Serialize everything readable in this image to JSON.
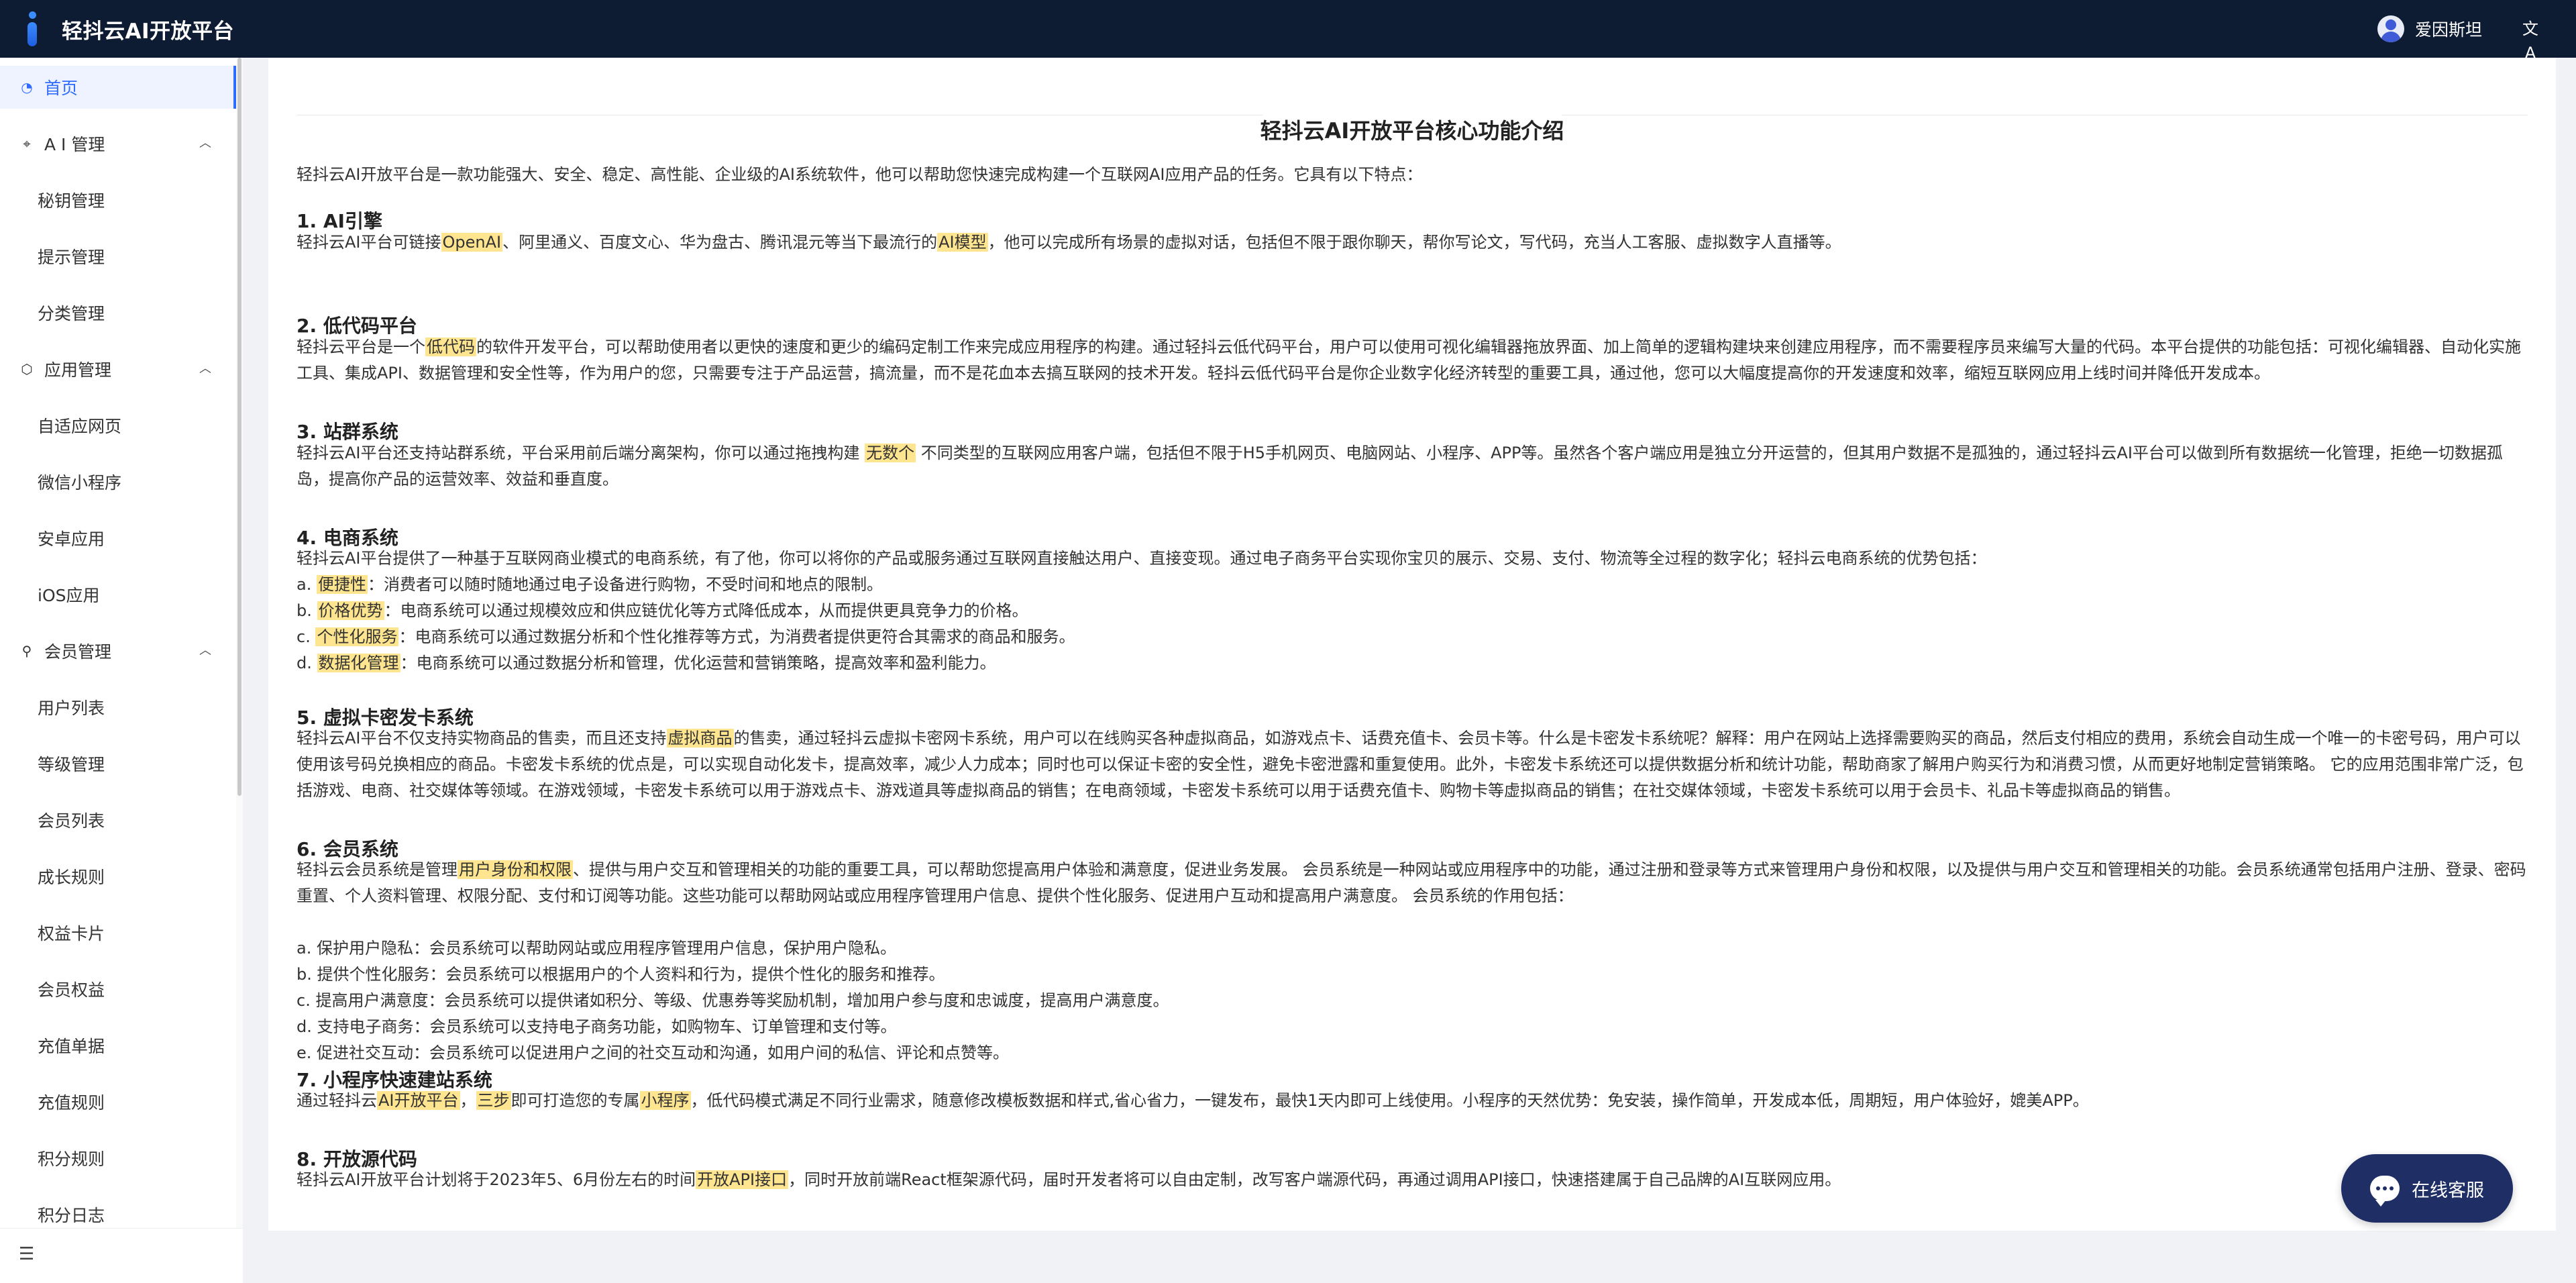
{
  "header": {
    "brand_title": "轻抖云AI开放平台",
    "user_name": "爱因斯坦",
    "lang_icon": "translate-icon"
  },
  "sidebar": {
    "home": "首页",
    "groups": [
      {
        "label": "A I 管理",
        "icon": "ai-icon",
        "items": [
          "秘钥管理",
          "提示管理",
          "分类管理"
        ]
      },
      {
        "label": "应用管理",
        "icon": "app-icon",
        "items": [
          "自适应网页",
          "微信小程序",
          "安卓应用",
          "iOS应用"
        ]
      },
      {
        "label": "会员管理",
        "icon": "user-icon",
        "items": [
          "用户列表",
          "等级管理",
          "会员列表",
          "成长规则",
          "权益卡片",
          "会员权益",
          "充值单据",
          "充值规则",
          "积分规则",
          "积分日志"
        ]
      }
    ]
  },
  "content": {
    "title": "轻抖云AI开放平台核心功能介绍",
    "intro": "轻抖云AI开放平台是一款功能强大、安全、稳定、高性能、企业级的AI系统软件，他可以帮助您快速完成构建一个互联网AI应用产品的任务。它具有以下特点：",
    "sections": [
      {
        "heading": "1. AI引擎",
        "paragraphs": [
          [
            {
              "t": "轻抖云AI平台可链接"
            },
            {
              "t": "OpenAI",
              "hl": true
            },
            {
              "t": "、阿里通义、百度文心、华为盘古、腾讯混元等当下最流行的"
            },
            {
              "t": "AI模型",
              "hl": true
            },
            {
              "t": "，他可以完成所有场景的虚拟对话，包括但不限于跟你聊天，帮你写论文，写代码，充当人工客服、虚拟数字人直播等。"
            }
          ]
        ]
      },
      {
        "heading": "2. 低代码平台",
        "paragraphs": [
          [
            {
              "t": "轻抖云平台是一个"
            },
            {
              "t": "低代码",
              "hl": true
            },
            {
              "t": "的软件开发平台，可以帮助使用者以更快的速度和更少的编码定制工作来完成应用程序的构建。通过轻抖云低代码平台，用户可以使用可视化编辑器拖放界面、加上简单的逻辑构建块来创建应用程序，而不需要程序员来编写大量的代码。本平台提供的功能包括：可视化编辑器、自动化实施工具、集成API、数据管理和安全性等，作为用户的您，只需要专注于产品运营，搞流量，而不是花血本去搞互联网的技术开发。轻抖云低代码平台是你企业数字化经济转型的重要工具，通过他，您可以大幅度提高你的开发速度和效率，缩短互联网应用上线时间并降低开发成本。"
            }
          ]
        ]
      },
      {
        "heading": "3. 站群系统",
        "paragraphs": [
          [
            {
              "t": "轻抖云AI平台还支持站群系统，平台采用前后端分离架构，你可以通过拖拽构建 "
            },
            {
              "t": "无数个",
              "hl": true
            },
            {
              "t": " 不同类型的互联网应用客户端，包括但不限于H5手机网页、电脑网站、小程序、APP等。虽然各个客户端应用是独立分开运营的，但其用户数据不是孤独的，通过轻抖云AI平台可以做到所有数据统一化管理，拒绝一切数据孤岛，提高你产品的运营效率、效益和垂直度。"
            }
          ]
        ]
      },
      {
        "heading": "4. 电商系统",
        "paragraphs": [
          [
            {
              "t": "轻抖云AI平台提供了一种基于互联网商业模式的电商系统，有了他，你可以将你的产品或服务通过互联网直接触达用户、直接变现。通过电子商务平台实现你宝贝的展示、交易、支付、物流等全过程的数字化；轻抖云电商系统的优势包括："
            }
          ],
          [
            {
              "t": "a. "
            },
            {
              "t": "便捷性",
              "hl": true
            },
            {
              "t": "：消费者可以随时随地通过电子设备进行购物，不受时间和地点的限制。"
            }
          ],
          [
            {
              "t": "b. "
            },
            {
              "t": "价格优势",
              "hl": true
            },
            {
              "t": "：电商系统可以通过规模效应和供应链优化等方式降低成本，从而提供更具竞争力的价格。"
            }
          ],
          [
            {
              "t": "c. "
            },
            {
              "t": "个性化服务",
              "hl": true
            },
            {
              "t": "：电商系统可以通过数据分析和个性化推荐等方式，为消费者提供更符合其需求的商品和服务。"
            }
          ],
          [
            {
              "t": "d. "
            },
            {
              "t": "数据化管理",
              "hl": true
            },
            {
              "t": "：电商系统可以通过数据分析和管理，优化运营和营销策略，提高效率和盈利能力。"
            }
          ]
        ]
      },
      {
        "heading": "5. 虚拟卡密发卡系统",
        "paragraphs": [
          [
            {
              "t": "轻抖云AI平台不仅支持实物商品的售卖，而且还支持"
            },
            {
              "t": "虚拟商品",
              "hl": true
            },
            {
              "t": "的售卖，通过轻抖云虚拟卡密网卡系统，用户可以在线购买各种虚拟商品，如游戏点卡、话费充值卡、会员卡等。什么是卡密发卡系统呢？解释：用户在网站上选择需要购买的商品，然后支付相应的费用，系统会自动生成一个唯一的卡密号码，用户可以使用该号码兑换相应的商品。卡密发卡系统的优点是，可以实现自动化发卡，提高效率，减少人力成本；同时也可以保证卡密的安全性，避免卡密泄露和重复使用。此外，卡密发卡系统还可以提供数据分析和统计功能，帮助商家了解用户购买行为和消费习惯，从而更好地制定营销策略。 它的应用范围非常广泛，包括游戏、电商、社交媒体等领域。在游戏领域，卡密发卡系统可以用于游戏点卡、游戏道具等虚拟商品的销售；在电商领域，卡密发卡系统可以用于话费充值卡、购物卡等虚拟商品的销售；在社交媒体领域，卡密发卡系统可以用于会员卡、礼品卡等虚拟商品的销售。"
            }
          ]
        ]
      },
      {
        "heading": "6. 会员系统",
        "paragraphs": [
          [
            {
              "t": "轻抖云会员系统是管理"
            },
            {
              "t": "用户身份和权限",
              "hl": true
            },
            {
              "t": "、提供与用户交互和管理相关的功能的重要工具，可以帮助您提高用户体验和满意度，促进业务发展。 会员系统是一种网站或应用程序中的功能，通过注册和登录等方式来管理用户身份和权限，以及提供与用户交互和管理相关的功能。会员系统通常包括用户注册、登录、密码重置、个人资料管理、权限分配、支付和订阅等功能。这些功能可以帮助网站或应用程序管理用户信息、提供个性化服务、促进用户互动和提高用户满意度。 会员系统的作用包括："
            }
          ],
          [
            {
              "t": "a. 保护用户隐私：会员系统可以帮助网站或应用程序管理用户信息，保护用户隐私。"
            }
          ],
          [
            {
              "t": "b. 提供个性化服务：会员系统可以根据用户的个人资料和行为，提供个性化的服务和推荐。"
            }
          ],
          [
            {
              "t": "c. 提高用户满意度：会员系统可以提供诸如积分、等级、优惠券等奖励机制，增加用户参与度和忠诚度，提高用户满意度。"
            }
          ],
          [
            {
              "t": "d. 支持电子商务：会员系统可以支持电子商务功能，如购物车、订单管理和支付等。"
            }
          ],
          [
            {
              "t": "e. 促进社交互动：会员系统可以促进用户之间的社交互动和沟通，如用户间的私信、评论和点赞等。"
            }
          ]
        ]
      },
      {
        "heading": "7. 小程序快速建站系统",
        "paragraphs": [
          [
            {
              "t": "通过轻抖云"
            },
            {
              "t": "AI开放平台",
              "hl": true
            },
            {
              "t": "，"
            },
            {
              "t": "三步",
              "hl": true
            },
            {
              "t": "即可打造您的专属"
            },
            {
              "t": "小程序",
              "hl": true
            },
            {
              "t": "，低代码模式满足不同行业需求，随意修改模板数据和样式,省心省力，一键发布，最快1天内即可上线使用。小程序的天然优势：免安装，操作简单，开发成本低，周期短，用户体验好，媲美APP。"
            }
          ]
        ]
      },
      {
        "heading": "8. 开放源代码",
        "paragraphs": [
          [
            {
              "t": "轻抖云AI开放平台计划将于2023年5、6月份左右的时间"
            },
            {
              "t": "开放API接口",
              "hl": true
            },
            {
              "t": "，同时开放前端React框架源代码，届时开发者将可以自由定制，改写客户端源代码，再通过调用API接口，快速搭建属于自己品牌的AI互联网应用。"
            }
          ]
        ]
      }
    ]
  },
  "chat": {
    "label": "在线客服"
  },
  "colors": {
    "header_bg": "#0d1b33",
    "accent": "#2f6bff",
    "highlight": "#ffe58f",
    "chat_bg": "#1f2f66"
  }
}
